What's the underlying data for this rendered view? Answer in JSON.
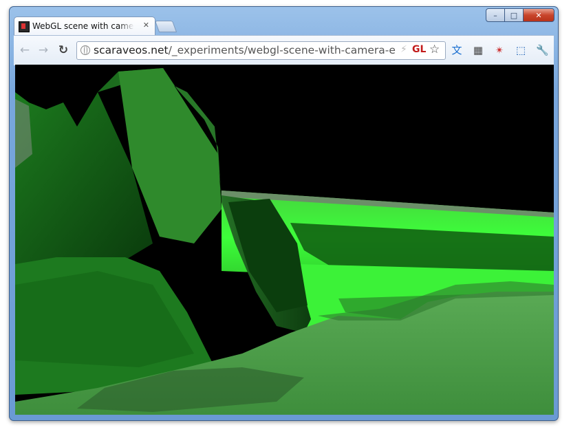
{
  "window": {
    "controls": {
      "minimize": "–",
      "maximize": "□",
      "close": "✕"
    }
  },
  "tab": {
    "title": "WebGL scene with camera elevation adjustment",
    "close_glyph": "✕"
  },
  "omnibox": {
    "url_host": "scaraveos.net",
    "url_path": "/_experiments/webgl-scene-with-camera-elevation-a",
    "gl_badge": "GL",
    "bolt_glyph": "⚡",
    "star_glyph": "☆"
  },
  "nav": {
    "back": "←",
    "forward": "→",
    "reload": "↻"
  },
  "extensions": [
    {
      "name": "translate-icon",
      "glyph": "文"
    },
    {
      "name": "qr-code-icon",
      "glyph": "▦"
    },
    {
      "name": "share-icon",
      "glyph": "✴"
    },
    {
      "name": "fullscreen-icon",
      "glyph": "⬚"
    },
    {
      "name": "wrench-icon",
      "glyph": "🔧"
    }
  ],
  "colors": {
    "sky": "#000000",
    "terrain_dark": "#0f4a12",
    "terrain_mid": "#1f8a24",
    "terrain_bright": "#3dff3a",
    "terrain_pale": "#4fae4c"
  }
}
